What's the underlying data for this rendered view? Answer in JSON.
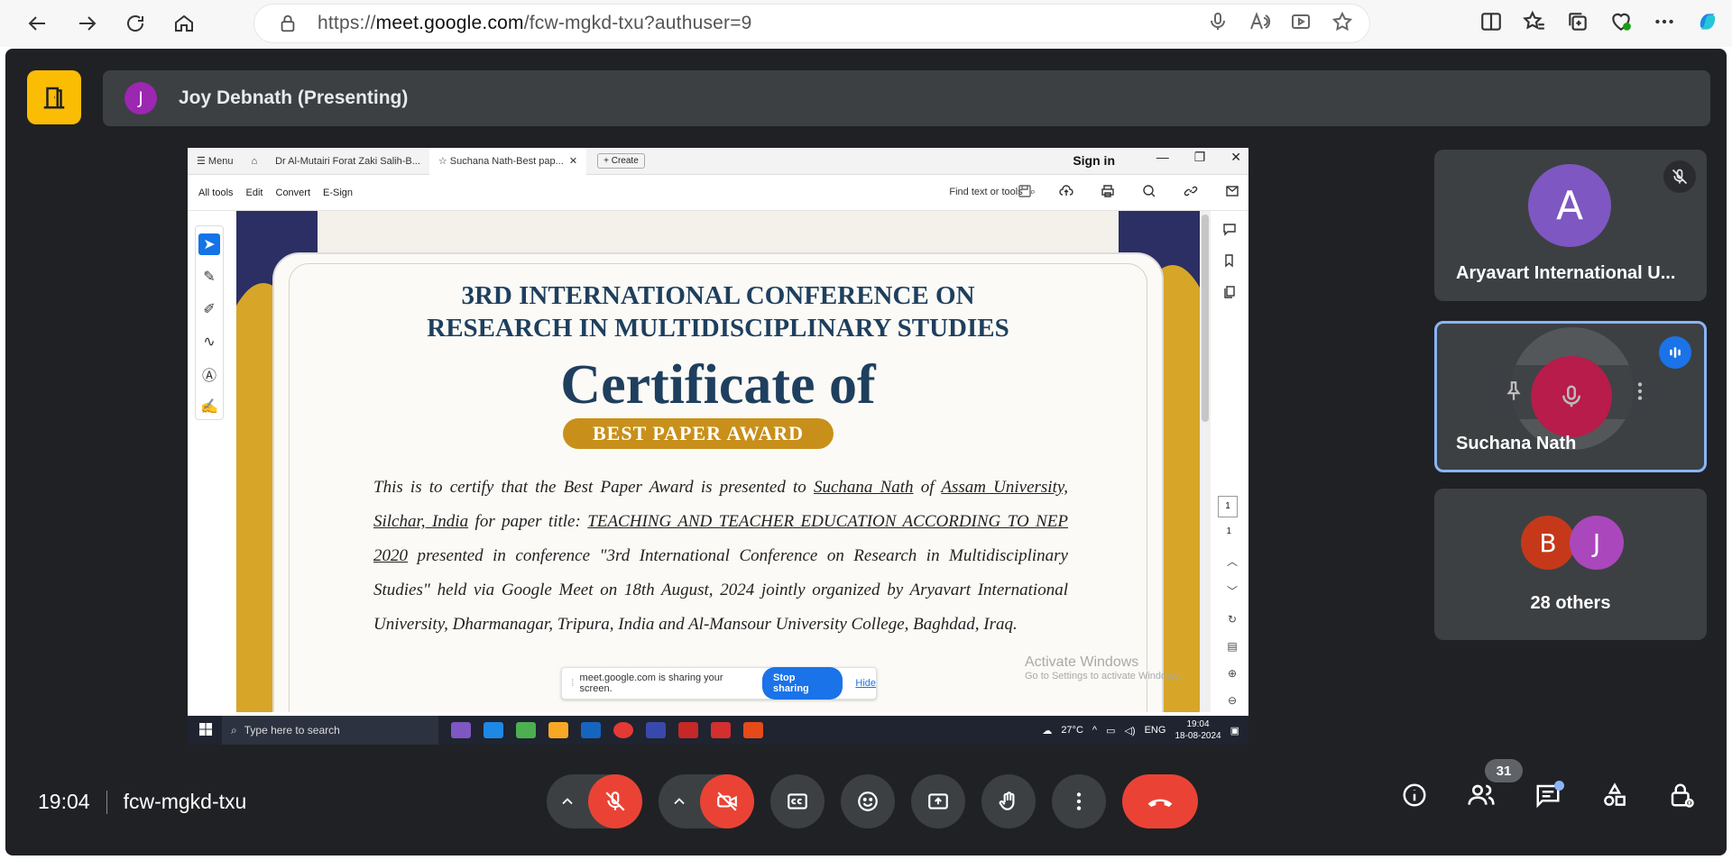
{
  "browser": {
    "url_prefix": "https://",
    "url_host": "meet.google.com",
    "url_path": "/fcw-mgkd-txu?authuser=9"
  },
  "meet": {
    "presenter_initial": "J",
    "presenter_label": "Joy Debnath (Presenting)",
    "time": "19:04",
    "meeting_code": "fcw-mgkd-txu",
    "participant_count": "31"
  },
  "shared_screen": {
    "tabs": [
      {
        "label": "Menu"
      },
      {
        "label": "Dr Al-Mutairi Forat Zaki Salih-B..."
      },
      {
        "label": "Suchana Nath-Best pap..."
      }
    ],
    "create_label": "Create",
    "sign_in": "Sign in",
    "menu_items": [
      "All tools",
      "Edit",
      "Convert",
      "E-Sign"
    ],
    "find_text": "Find text or tools",
    "page_current": "1",
    "page_total": "1",
    "certificate": {
      "title_line1": "3RD INTERNATIONAL CONFERENCE ON",
      "title_line2": "RESEARCH IN MULTIDISCIPLINARY STUDIES",
      "big_title": "Certificate of",
      "award": "BEST PAPER AWARD",
      "body_part1": "This is to certify that the Best Paper Award is presented to ",
      "recipient": "Suchana Nath",
      "body_part2": " of ",
      "institution": "Assam University, Silchar, India",
      "body_part3": " for paper title: ",
      "paper_title": "TEACHING AND TEACHER EDUCATION ACCORDING TO NEP 2020",
      "body_part4": " presented in conference \"3rd International Conference on Research in Multidisciplinary Studies\" held via Google Meet on 18th August, 2024 jointly organized by Aryavart International University, Dharmanagar, Tripura, India and Al-Mansour University College, Baghdad, Iraq."
    },
    "activate_title": "Activate Windows",
    "activate_sub": "Go to Settings to activate Windows.",
    "share_text": "meet.google.com is sharing your screen.",
    "stop_sharing": "Stop sharing",
    "hide": "Hide",
    "taskbar": {
      "search_placeholder": "Type here to search",
      "weather": "27°C",
      "lang": "ENG",
      "clock_time": "19:04",
      "clock_date": "18-08-2024"
    }
  },
  "tiles": [
    {
      "initial": "A",
      "name": "Aryavart International U...",
      "avatar_color": "#7e57c2"
    },
    {
      "name": "Suchana Nath"
    },
    {
      "initials": [
        "B",
        "J"
      ],
      "name": "28 others",
      "colors": [
        "#c5391a",
        "#ab47bc"
      ]
    }
  ]
}
